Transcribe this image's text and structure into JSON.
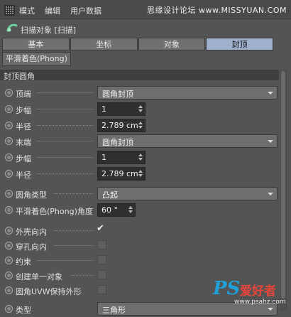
{
  "menubar": {
    "icon": "grid-icon",
    "items": [
      {
        "label": "模式"
      },
      {
        "label": "编辑"
      },
      {
        "label": "用户数据"
      }
    ],
    "watermark": "思缘设计论坛 www.MISSYUAN.COM"
  },
  "object": {
    "icon": "sweep-object-icon",
    "title": "扫描对象 [扫描]"
  },
  "tabs": [
    {
      "label": "基本",
      "active": false
    },
    {
      "label": "坐标",
      "active": false
    },
    {
      "label": "对象",
      "active": false
    },
    {
      "label": "封顶",
      "active": true
    }
  ],
  "subtab": "平滑着色(Phong)",
  "section_title": "封顶圆角",
  "rows": [
    {
      "label": "顶端",
      "type": "dropdown",
      "value": "圆角封顶"
    },
    {
      "label": "步幅",
      "type": "number",
      "value": "1"
    },
    {
      "label": "半径",
      "type": "number",
      "value": "2.789 cm"
    },
    {
      "label": "末端",
      "type": "dropdown",
      "value": "圆角封顶"
    },
    {
      "label": "步幅",
      "type": "number",
      "value": "1"
    },
    {
      "label": "半径",
      "type": "number",
      "value": "2.789 cm"
    },
    {
      "label": "圆角类型",
      "type": "dropdown",
      "value": "凸起"
    },
    {
      "label": "平滑着色(Phong)角度",
      "type": "number",
      "value": "60 °"
    },
    {
      "label": "外壳向内",
      "type": "checkbox",
      "checked": true
    },
    {
      "label": "穿孔向内",
      "type": "checkbox",
      "checked": false
    },
    {
      "label": "约束",
      "type": "checkbox",
      "checked": false
    },
    {
      "label": "创建单一对象",
      "type": "checkbox",
      "checked": false
    },
    {
      "label": "圆角UVW保持外形",
      "type": "checkbox",
      "checked": false
    },
    {
      "label": "类型",
      "type": "dropdown",
      "value": "三角形"
    }
  ],
  "watermark": {
    "ps": "PS",
    "cn": "爱好者",
    "url": "www.psahz.com"
  },
  "colors": {
    "panel_bg": "#545454",
    "active_tab": "#9fb0cc",
    "watermark_blue": "#1fa0d8",
    "watermark_red": "#e8443a"
  }
}
